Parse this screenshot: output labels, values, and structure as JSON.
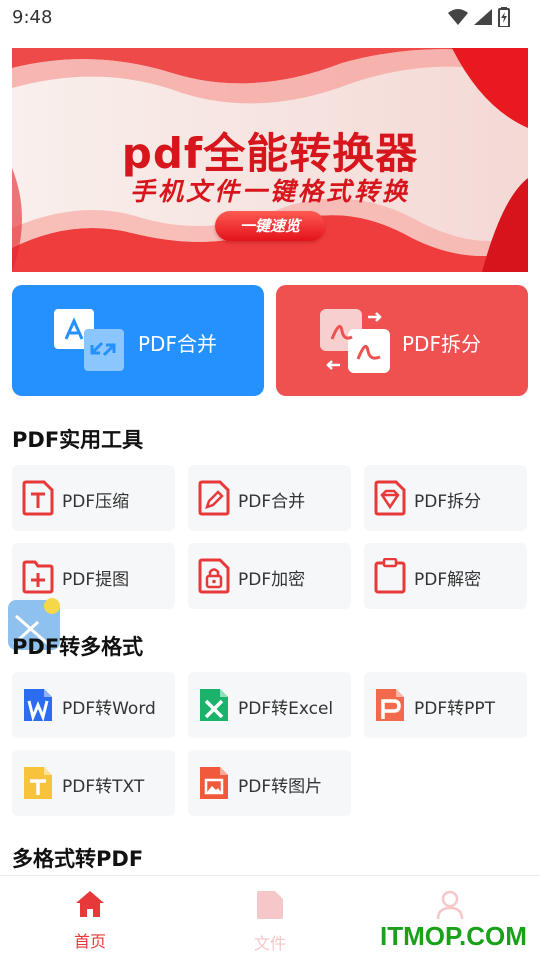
{
  "status_bar": {
    "time": "9:48"
  },
  "banner": {
    "title": "pdf全能转换器",
    "subtitle": "手机文件一键格式转换",
    "button": "一键速览"
  },
  "big_buttons": [
    {
      "label": "PDF合并",
      "icon": "merge-icon",
      "color": "#2491ff"
    },
    {
      "label": "PDF拆分",
      "icon": "split-icon",
      "color": "#ef5050"
    }
  ],
  "sections": [
    {
      "title": "PDF实用工具",
      "items": [
        {
          "label": "PDF压缩",
          "icon": "compress-icon"
        },
        {
          "label": "PDF合并",
          "icon": "edit-merge-icon"
        },
        {
          "label": "PDF拆分",
          "icon": "diamond-split-icon"
        },
        {
          "label": "PDF提图",
          "icon": "folder-add-icon"
        },
        {
          "label": "PDF加密",
          "icon": "lock-icon"
        },
        {
          "label": "PDF解密",
          "icon": "clipboard-icon"
        }
      ]
    },
    {
      "title": "PDF转多格式",
      "items": [
        {
          "label": "PDF转Word",
          "icon": "word-icon",
          "color": "#2b6cf0"
        },
        {
          "label": "PDF转Excel",
          "icon": "excel-icon",
          "color": "#1bb36b"
        },
        {
          "label": "PDF转PPT",
          "icon": "ppt-icon",
          "color": "#f26a4b"
        },
        {
          "label": "PDF转TXT",
          "icon": "txt-icon",
          "color": "#f7c23c"
        },
        {
          "label": "PDF转图片",
          "icon": "image-icon",
          "color": "#f05a3a"
        }
      ]
    },
    {
      "title": "多格式转PDF"
    }
  ],
  "bottom_nav": [
    {
      "label": "首页",
      "icon": "home-icon",
      "active": true
    },
    {
      "label": "文件",
      "icon": "file-icon",
      "active": false
    },
    {
      "label": "",
      "icon": "user-icon",
      "active": false
    }
  ],
  "watermark": "ITMOP.COM",
  "colors": {
    "accent_red": "#e8393a",
    "inactive": "#f6c7c8",
    "card_bg": "#f6f7f9"
  }
}
